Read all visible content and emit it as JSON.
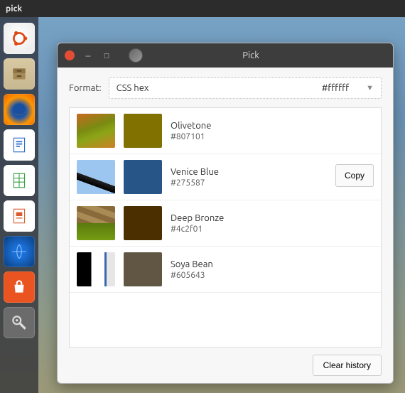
{
  "topbar": {
    "title": "pick"
  },
  "launcher": {
    "items": [
      {
        "name": "ubuntu-dash"
      },
      {
        "name": "files"
      },
      {
        "name": "firefox"
      },
      {
        "name": "writer"
      },
      {
        "name": "calc"
      },
      {
        "name": "impress"
      },
      {
        "name": "marble"
      },
      {
        "name": "software-store"
      },
      {
        "name": "settings"
      }
    ]
  },
  "window": {
    "title": "Pick",
    "format_label": "Format:",
    "format": {
      "name": "CSS hex",
      "preview": "#ffffff"
    },
    "copy_label": "Copy",
    "clear_label": "Clear history",
    "history": [
      {
        "name": "Olivetone",
        "code": "#807101",
        "swatch": "#807101"
      },
      {
        "name": "Venice Blue",
        "code": "#275587",
        "swatch": "#275587"
      },
      {
        "name": "Deep Bronze",
        "code": "#4c2f01",
        "swatch": "#4c2f01"
      },
      {
        "name": "Soya Bean",
        "code": "#605643",
        "swatch": "#605643"
      }
    ],
    "hovered_index": 1
  }
}
